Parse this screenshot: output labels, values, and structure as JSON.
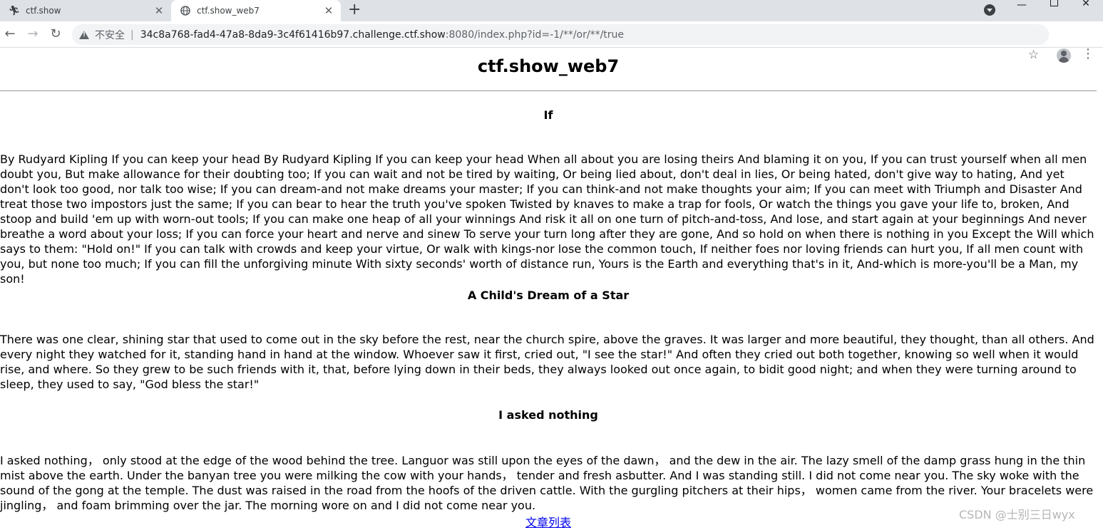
{
  "tabs": [
    {
      "title": "ctf.show",
      "icon": "runner-icon"
    },
    {
      "title": "ctf.show_web7",
      "icon": "globe-icon",
      "active": true
    }
  ],
  "address_bar": {
    "security_label": "不安全",
    "host": "34c8a768-fad4-47a8-8da9-3c4f61416b97.challenge.ctf.show",
    "rest": ":8080/index.php?id=-1/**/or/**/true"
  },
  "page": {
    "title": "ctf.show_web7",
    "articles": [
      {
        "title": "If",
        "body": "By Rudyard Kipling If you can keep your head By Rudyard Kipling If you can keep your head When all about you are losing theirs And blaming it on you, If you can trust yourself when all men doubt you, But make allowance for their doubting too; If you can wait and not be tired by waiting, Or being lied about, don't deal in lies, Or being hated, don't give way to hating, And yet don't look too good, nor talk too wise; If you can dream-and not make dreams your master; If you can think-and not make thoughts your aim; If you can meet with Triumph and Disaster And treat those two impostors just the same; If you can bear to hear the truth you've spoken Twisted by knaves to make a trap for fools, Or watch the things you gave your life to, broken, And stoop and build 'em up with worn-out tools; If you can make one heap of all your winnings And risk it all on one turn of pitch-and-toss, And lose, and start again at your beginnings And never breathe a word about your loss; If you can force your heart and nerve and sinew To serve your turn long after they are gone, And so hold on when there is nothing in you Except the Will which says to them: \"Hold on!\" If you can talk with crowds and keep your virtue, Or walk with kings-nor lose the common touch, If neither foes nor loving friends can hurt you, If all men count with you, but none too much; If you can fill the unforgiving minute With sixty seconds' worth of distance run, Yours is the Earth and everything that's in it, And-which is more-you'll be a Man, my son!"
      },
      {
        "title": "A Child's Dream of a Star",
        "body": "There was one clear, shining star that used to come out in the sky before the rest, near the church spire, above the graves. It was larger and more beautiful, they thought, than all others. And every night they watched for it, standing hand in hand at the window. Whoever saw it first, cried out, \"I see the star!\" And often they cried out both together, knowing so well when it would rise, and where. So they grew to be such friends with it, that, before lying down in their beds, they always looked out once again, to bidit good night; and when they were turning around to sleep, they used to say, \"God bless the star!\""
      },
      {
        "title": "I asked nothing",
        "body": "I asked nothing， only stood at the edge of the wood behind the tree. Languor was still upon the eyes of the dawn， and the dew in the air. The lazy smell of the damp grass hung in the thin mist above the earth. Under the banyan tree you were milking the cow with your hands， tender and fresh asbutter. And I was standing still. I did not come near you. The sky woke with the sound of the gong at the temple. The dust was raised in the road from the hoofs of the driven cattle. With the gurgling pitchers at their hips， women came from the river. Your bracelets were jingling， and foam brimming over the jar. The morning wore on and I did not come near you."
      }
    ],
    "list_link": "文章列表"
  },
  "watermark": "CSDN @士别三日wyx"
}
